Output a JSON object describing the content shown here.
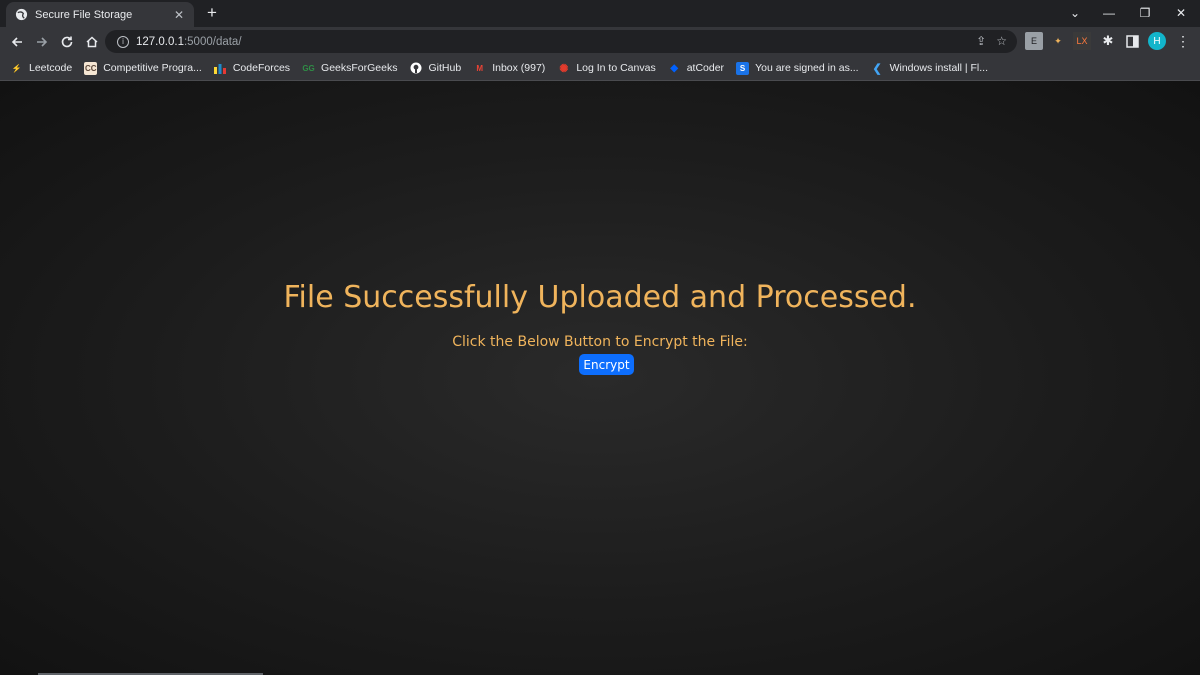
{
  "browser": {
    "tab": {
      "title": "Secure File Storage",
      "close": "✕"
    },
    "new_tab": "+",
    "window": {
      "dropdown": "⌄",
      "minimize": "—",
      "restore": "❐",
      "close": "✕"
    },
    "address": {
      "host": "127.0.0.1",
      "path": ":5000/data/"
    },
    "extensions": [
      "E",
      "LX",
      "H"
    ]
  },
  "bookmarks": [
    {
      "label": "Leetcode",
      "icon": "leetcode-icon",
      "glyph": "⚡",
      "color": "#ffa116"
    },
    {
      "label": "Competitive Progra...",
      "icon": "codechef-icon",
      "glyph": "CC",
      "color": "#c8a07a"
    },
    {
      "label": "CodeForces",
      "icon": "codeforces-icon",
      "glyph": "▮",
      "color": "#1f8acb"
    },
    {
      "label": "GeeksForGeeks",
      "icon": "gfg-icon",
      "glyph": "GG",
      "color": "#2f8d46"
    },
    {
      "label": "GitHub",
      "icon": "github-icon",
      "glyph": "●",
      "color": "#ffffff"
    },
    {
      "label": "Inbox (997)",
      "icon": "gmail-icon",
      "glyph": "M",
      "color": "#ea4335"
    },
    {
      "label": "Log In to Canvas",
      "icon": "canvas-icon",
      "glyph": "✺",
      "color": "#e33b2c"
    },
    {
      "label": "atCoder",
      "icon": "dropbox-icon",
      "glyph": "◆",
      "color": "#0061fe"
    },
    {
      "label": "You are signed in as...",
      "icon": "s-icon",
      "glyph": "S",
      "color": "#1a73e8"
    },
    {
      "label": "Windows install | Fl...",
      "icon": "flutter-icon",
      "glyph": "❮",
      "color": "#42a5f5"
    }
  ],
  "page": {
    "heading": "File Successfully Uploaded and Processed.",
    "subtext": "Click the Below Button to Encrypt the File:",
    "button_label": "Encrypt"
  }
}
